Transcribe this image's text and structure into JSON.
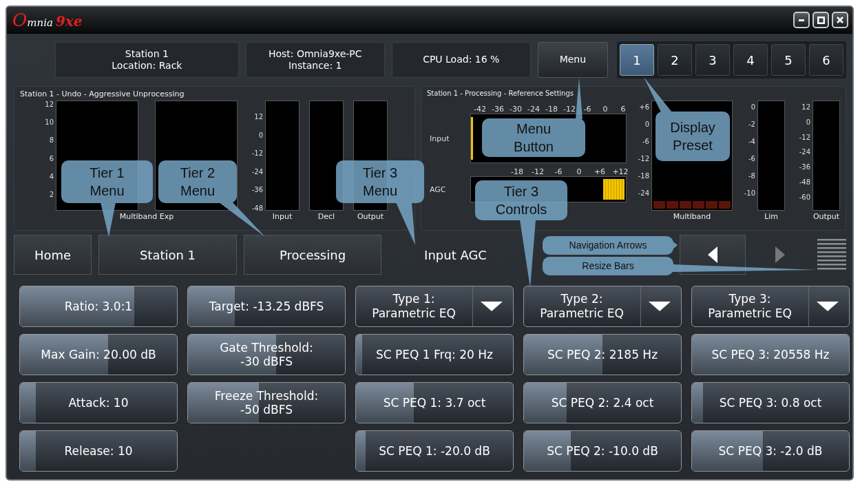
{
  "window": {
    "logo": {
      "brand": "Omnia",
      "model": "9xe"
    }
  },
  "header": {
    "station": [
      "Station 1",
      "Location: Rack"
    ],
    "host": [
      "Host: Omnia9xe-PC",
      "Instance: 1"
    ],
    "cpu": "CPU Load: 16 %",
    "menu_button": "Menu",
    "presets": [
      {
        "label": "1",
        "selected": true
      },
      {
        "label": "2",
        "selected": false
      },
      {
        "label": "3",
        "selected": false
      },
      {
        "label": "4",
        "selected": false
      },
      {
        "label": "5",
        "selected": false
      },
      {
        "label": "6",
        "selected": false
      }
    ]
  },
  "left_panel": {
    "title": "Station 1 - Undo - Aggressive Unprocessing",
    "expander_scale": [
      "12",
      "10",
      "8",
      "6",
      "4",
      "2"
    ],
    "expander_label": "Multiband Exp",
    "level_scale": [
      "12",
      "0",
      "-12",
      "-24",
      "-36",
      "-48"
    ],
    "meters": [
      {
        "label": "Input"
      },
      {
        "label": "Decl"
      },
      {
        "label": "Output"
      }
    ]
  },
  "right_panel": {
    "title": "Station 1 - Processing - Reference Settings",
    "input_meter": {
      "label": "Input",
      "scale": [
        "-42",
        "-36",
        "-30",
        "-24",
        "-18",
        "-12",
        "-6",
        "0",
        "6"
      ],
      "level": 0.01
    },
    "agc_meter": {
      "label": "AGC",
      "scale": [
        "-18",
        "-12",
        "-6",
        "0",
        "+6",
        "+12"
      ],
      "level": 0.14
    },
    "multiband": {
      "label": "Multiband",
      "scale": [
        "+6",
        "0",
        "-6",
        "-12",
        "-18",
        "-24"
      ],
      "bands": [
        {
          "level": 0.07
        },
        {
          "level": 0.07
        },
        {
          "level": 0.07
        },
        {
          "level": 0.07
        },
        {
          "level": 0.07
        },
        {
          "level": 0.07
        }
      ]
    },
    "lim": {
      "label": "Lim",
      "scale": [
        "0",
        "-2",
        "-4",
        "-6",
        "-8",
        "-10"
      ]
    },
    "output": {
      "label": "Output",
      "scale": [
        "12",
        "0",
        "-12",
        "-24",
        "-36",
        "-48",
        "-60"
      ]
    }
  },
  "navigation": {
    "breadcrumbs": [
      {
        "label": "Home",
        "kind": "button"
      },
      {
        "label": "Station 1",
        "kind": "button"
      },
      {
        "label": "Processing",
        "kind": "button"
      },
      {
        "label": "Input AGC",
        "kind": "current"
      }
    ],
    "back_enabled": true,
    "forward_enabled": false
  },
  "controls": [
    [
      {
        "kind": "slider",
        "label": "Ratio: 3.0:1",
        "level": 0.73
      },
      {
        "kind": "slider",
        "label": "Max Gain: 20.00 dB",
        "level": 0.56
      },
      {
        "kind": "slider",
        "label": "Attack: 10",
        "level": 0.1
      },
      {
        "kind": "slider",
        "label": "Release: 10",
        "level": 0.1
      }
    ],
    [
      {
        "kind": "slider",
        "label": "Target: -13.25 dBFS",
        "level": 0.3
      },
      {
        "kind": "slider",
        "label": "Gate Threshold:\n-30 dBFS",
        "level": 0.56
      },
      {
        "kind": "slider",
        "label": "Freeze Threshold:\n-50 dBFS",
        "level": 0.45
      }
    ],
    [
      {
        "kind": "dropdown",
        "label": "Type 1:\nParametric EQ"
      },
      {
        "kind": "slider",
        "label": "SC PEQ 1 Frq: 20 Hz",
        "level": 0.04
      },
      {
        "kind": "slider",
        "label": "SC PEQ 1: 3.7 oct",
        "level": 0.37
      },
      {
        "kind": "slider",
        "label": "SC PEQ 1: -20.0 dB",
        "level": 0.06
      }
    ],
    [
      {
        "kind": "dropdown",
        "label": "Type 2:\nParametric EQ"
      },
      {
        "kind": "slider",
        "label": "SC PEQ 2: 2185 Hz",
        "level": 0.5
      },
      {
        "kind": "slider",
        "label": "SC PEQ 2: 2.4 oct",
        "level": 0.27
      },
      {
        "kind": "slider",
        "label": "SC PEQ 2: -10.0 dB",
        "level": 0.3
      }
    ],
    [
      {
        "kind": "dropdown",
        "label": "Type 3:\nParametric EQ"
      },
      {
        "kind": "slider",
        "label": "SC PEQ 3: 20558 Hz",
        "level": 1
      },
      {
        "kind": "slider",
        "label": "SC PEQ 3: 0.8 oct",
        "level": 0.07
      },
      {
        "kind": "slider",
        "label": "SC PEQ 3: -2.0 dB",
        "level": 0.45
      }
    ]
  ],
  "callouts": [
    "Menu Button",
    "Display Preset",
    "Tier 1 Menu",
    "Tier 2 Menu",
    "Tier 3 Menu",
    "Tier 3 Controls",
    "Navigation Arrows",
    "Resize Bars"
  ]
}
